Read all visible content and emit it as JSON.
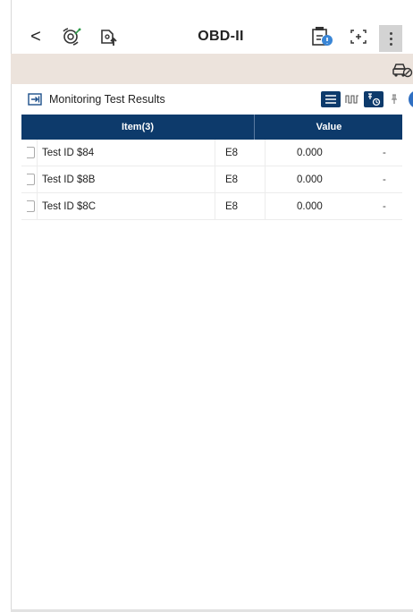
{
  "header": {
    "back_glyph": "<",
    "title": "OBD-II",
    "icons": [
      "scan-settings-icon",
      "upload-icon",
      "report-icon",
      "fit-screen-icon",
      "more-vert-icon",
      "car-diagnostic-icon"
    ]
  },
  "section": {
    "title": "Monitoring Test Results",
    "view_icons": [
      "list-view-icon",
      "waveform-icon",
      "filter-icon",
      "pin-icon"
    ]
  },
  "table": {
    "columns": [
      "Item(3)",
      "Value"
    ],
    "rows": [
      {
        "name": "Test ID $84",
        "unit": "E8",
        "value": "0.000",
        "extra": "-"
      },
      {
        "name": "Test ID $8B",
        "unit": "E8",
        "value": "0.000",
        "extra": "-"
      },
      {
        "name": "Test ID $8C",
        "unit": "E8",
        "value": "0.000",
        "extra": "-"
      }
    ]
  },
  "colors": {
    "accent": "#0d3a6b",
    "strip": "#ece3dc",
    "indicator": "#2f6fc2"
  }
}
